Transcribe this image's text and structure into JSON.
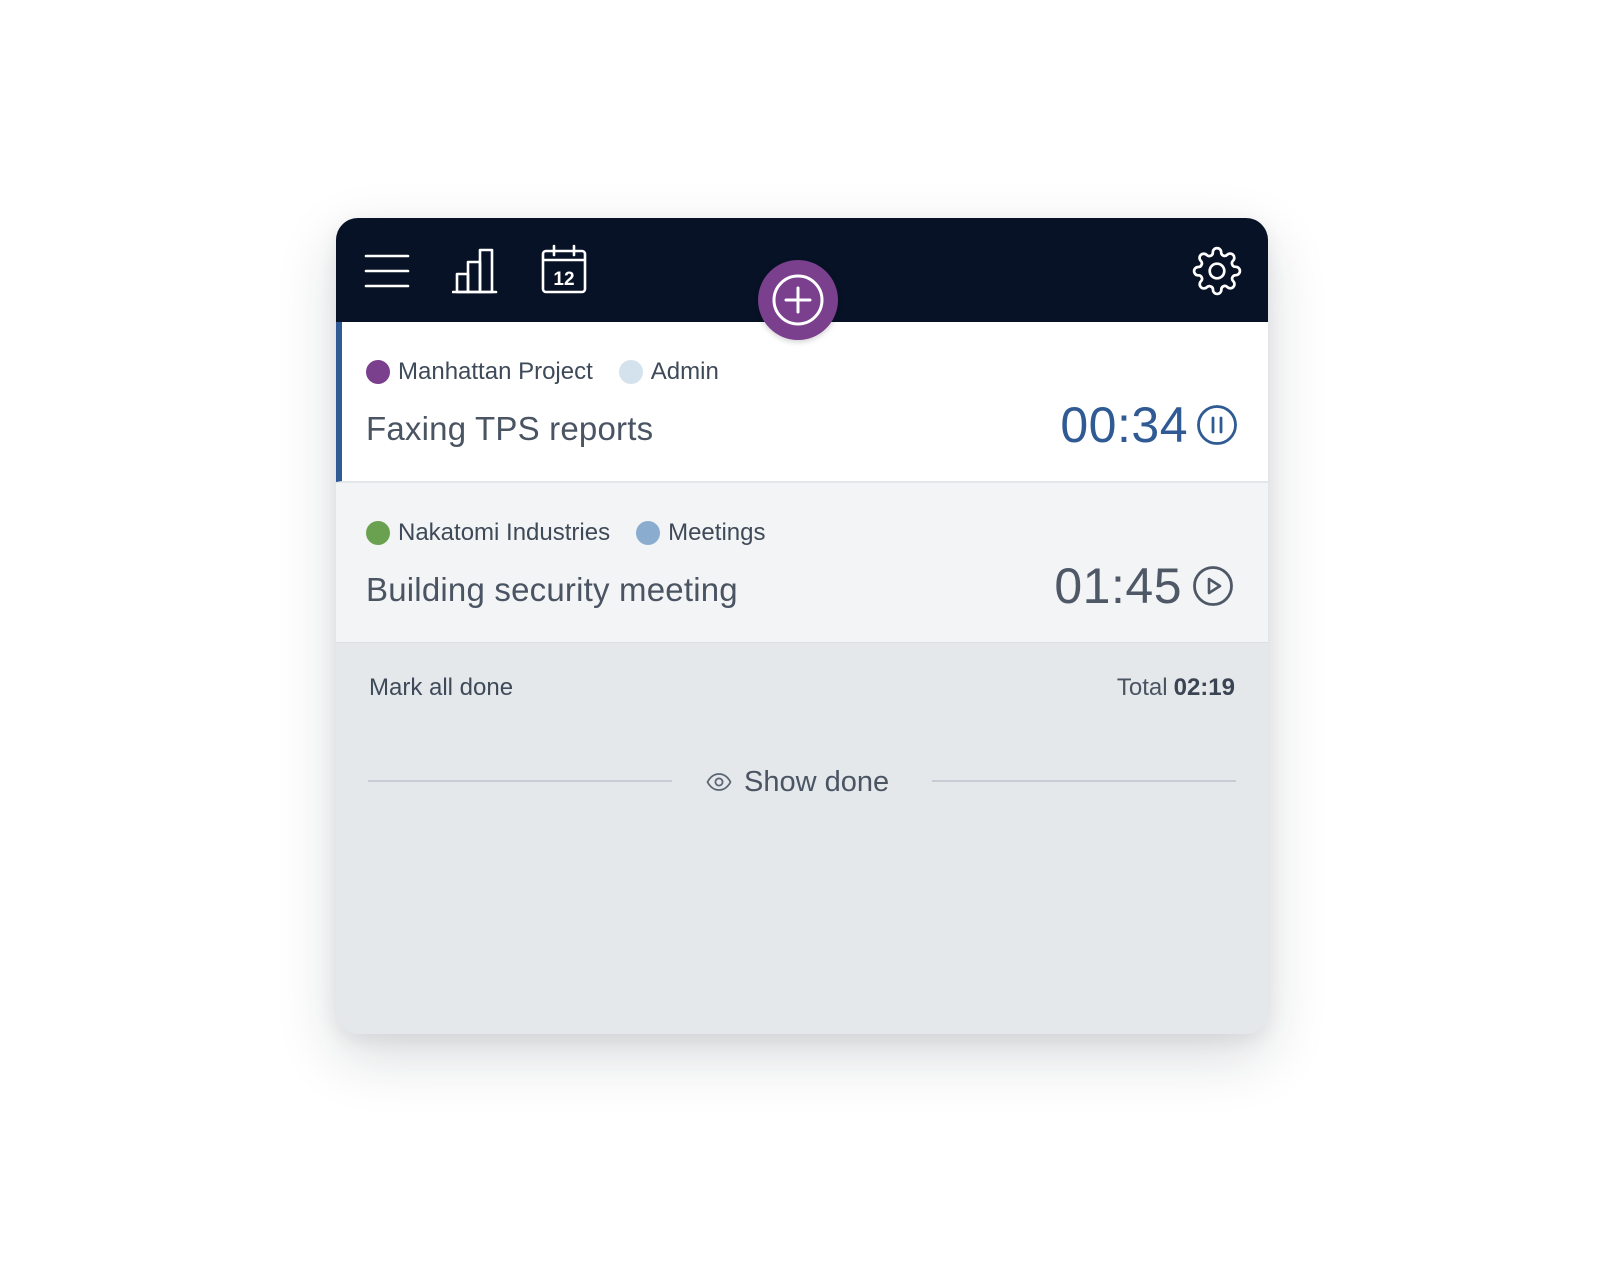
{
  "toolbar": {
    "menu_icon": "hamburger-menu-icon",
    "stats_icon": "bar-chart-icon",
    "calendar_icon": "calendar-icon",
    "calendar_day": "12",
    "add_icon": "plus-circle-icon",
    "settings_icon": "gear-icon"
  },
  "entries": [
    {
      "project": "Manhattan Project",
      "project_color": "#7a3f8d",
      "category": "Admin",
      "category_color": "#d4e2ee",
      "title": "Faxing TPS reports",
      "time": "00:34",
      "state": "running",
      "control_icon": "pause-icon"
    },
    {
      "project": "Nakatomi Industries",
      "project_color": "#6aa150",
      "category": "Meetings",
      "category_color": "#8aaccf",
      "title": "Building security meeting",
      "time": "01:45",
      "state": "stopped",
      "control_icon": "play-icon"
    }
  ],
  "footer": {
    "mark_all_done": "Mark all done",
    "total_label": "Total",
    "total_value": "02:19",
    "show_done": "Show done",
    "show_done_icon": "eye-icon"
  },
  "colors": {
    "topbar": "#081226",
    "accent": "#2f5a94",
    "add_button": "#7a3f8d",
    "panel_background": "#e5e8eb"
  }
}
